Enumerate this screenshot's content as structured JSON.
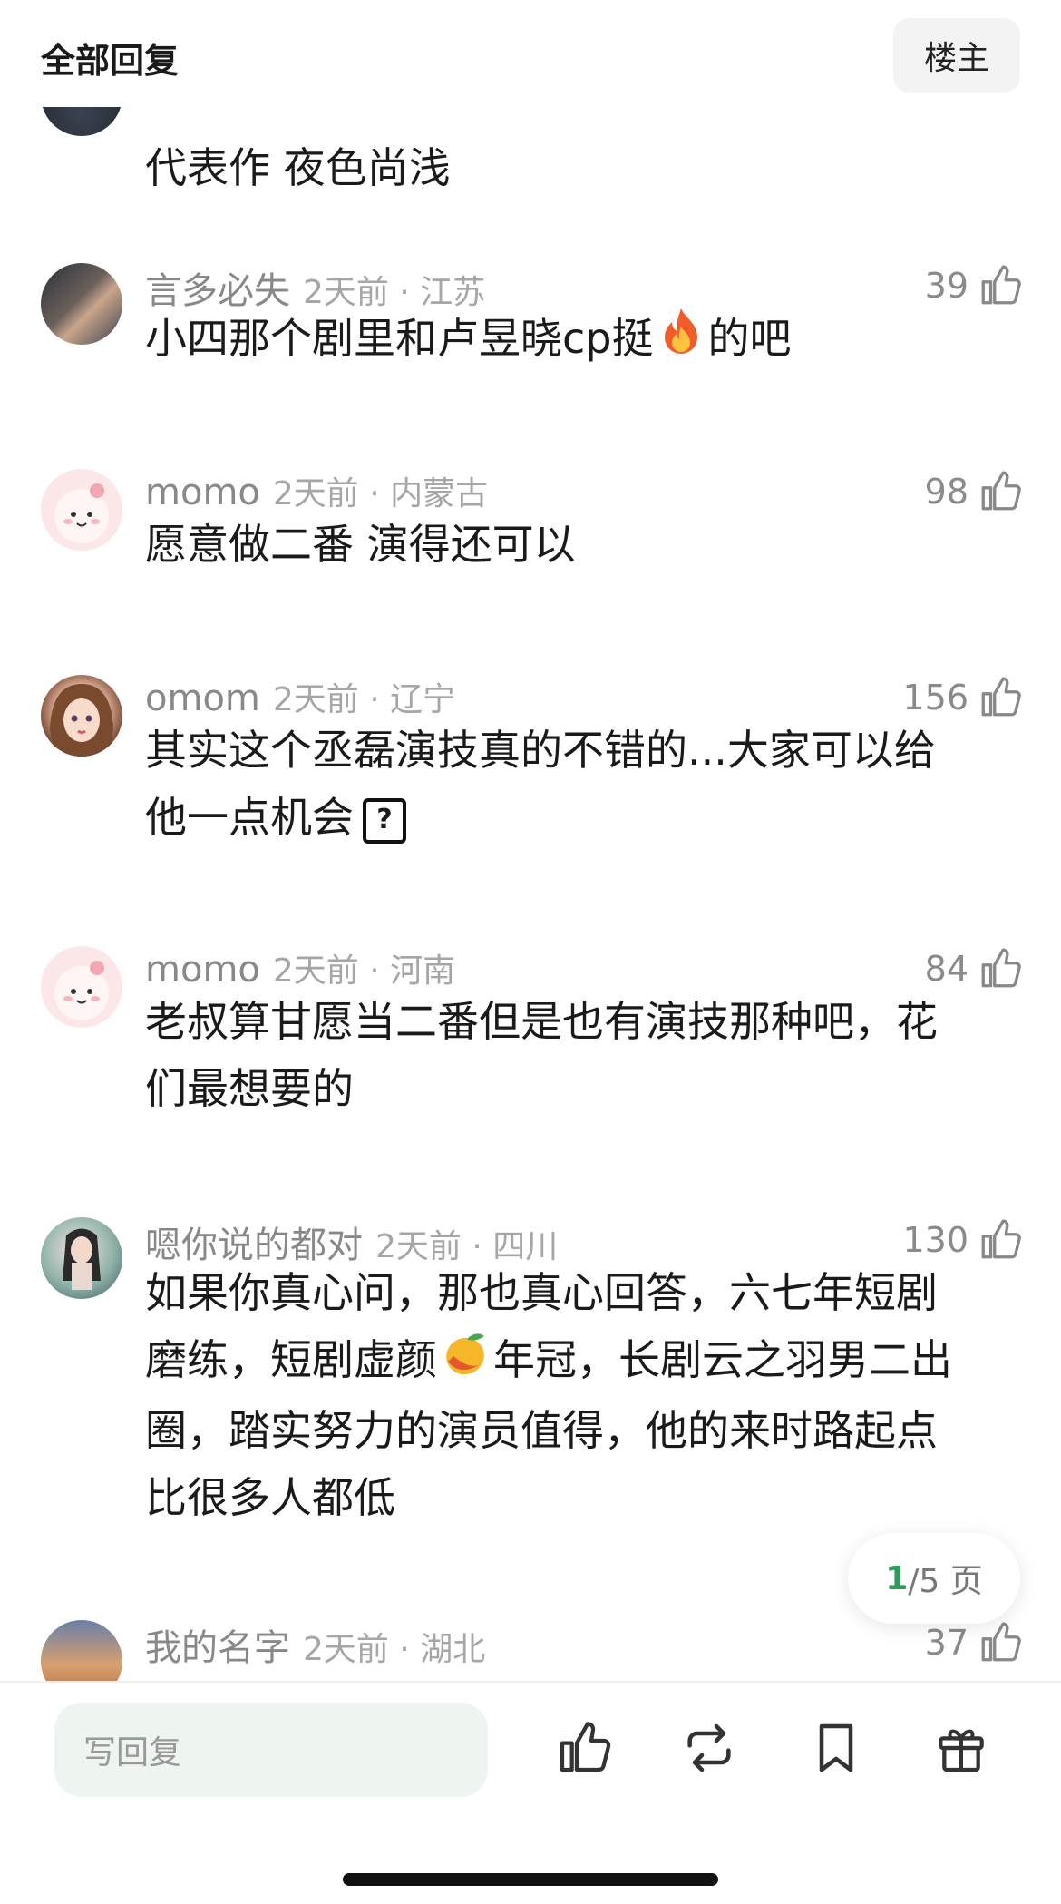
{
  "header": {
    "title": "全部回复",
    "op_label": "楼主"
  },
  "comments": [
    {
      "name": "",
      "time": "",
      "likes": "",
      "text": "代表作 夜色尚浅"
    },
    {
      "name": "言多必失",
      "time": "2天前 · 江苏",
      "likes": "39",
      "text_a": "小四那个剧里和卢昱晓cp挺",
      "text_b": "的吧",
      "emoji": "fire"
    },
    {
      "name": "momo",
      "time": "2天前 · 内蒙古",
      "likes": "98",
      "text": "愿意做二番 演得还可以"
    },
    {
      "name": "omom",
      "time": "2天前 · 辽宁",
      "likes": "156",
      "line1": "其实这个丞磊演技真的不错的...大家可以给",
      "line2": "他一点机会",
      "qmark": "?"
    },
    {
      "name": "momo",
      "time": "2天前 · 河南",
      "likes": "84",
      "line1": "老叔算甘愿当二番但是也有演技那种吧，花",
      "line2": "们最想要的"
    },
    {
      "name": "嗯你说的都对",
      "time": "2天前 · 四川",
      "likes": "130",
      "line1": "如果你真心问，那也真心回答，六七年短剧",
      "line2a": "磨练，短剧虚颜",
      "line2b": "年冠，长剧云之羽男二出",
      "line3": "圈，踏实努力的演员值得，他的来时路起点",
      "line4": "比很多人都低",
      "emoji": "mango"
    },
    {
      "name": "我的名字",
      "time": "2天前 · 湖北",
      "likes": "37"
    }
  ],
  "pager": {
    "current": "1",
    "total_suffix": "/5 页"
  },
  "bottom_bar": {
    "reply_placeholder": "写回复"
  },
  "colors": {
    "accent": "#2f9b5b",
    "meta_gray": "#8a8a8a",
    "input_bg": "#eef5f0"
  }
}
